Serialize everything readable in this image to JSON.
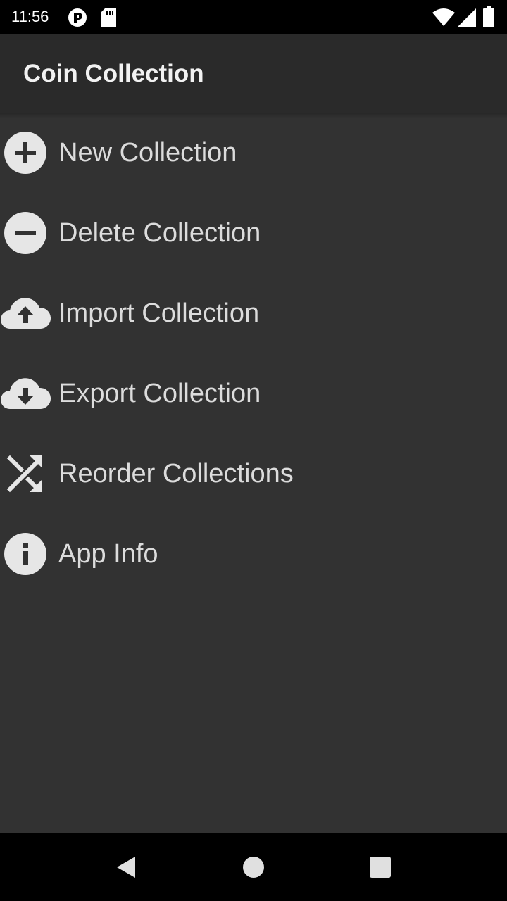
{
  "status_bar": {
    "time": "11:56",
    "icons": [
      "notification-app-icon",
      "sd-card-icon",
      "wifi-icon",
      "cell-signal-icon",
      "battery-icon"
    ]
  },
  "app_bar": {
    "title": "Coin Collection"
  },
  "menu": {
    "items": [
      {
        "label": "New Collection",
        "icon": "add-circle-icon"
      },
      {
        "label": "Delete Collection",
        "icon": "remove-circle-icon"
      },
      {
        "label": "Import Collection",
        "icon": "cloud-upload-icon"
      },
      {
        "label": "Export Collection",
        "icon": "cloud-download-icon"
      },
      {
        "label": "Reorder Collections",
        "icon": "shuffle-icon"
      },
      {
        "label": "App Info",
        "icon": "info-icon"
      }
    ]
  },
  "nav_bar": {
    "buttons": [
      "back-icon",
      "home-icon",
      "recents-icon"
    ]
  },
  "colors": {
    "background": "#323232",
    "app_bar": "#2a2a2a",
    "text": "#dcdcdc",
    "icon": "#e6e6e6"
  }
}
